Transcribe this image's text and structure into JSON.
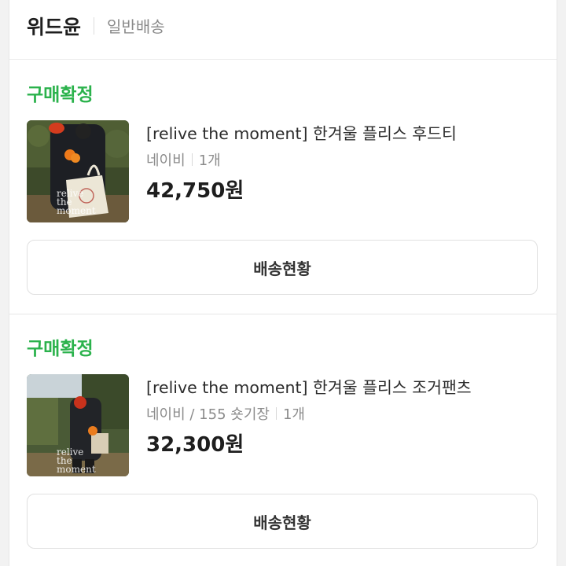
{
  "seller": {
    "name": "위드윤",
    "shipping_type": "일반배송"
  },
  "orders": [
    {
      "status": "구매확정",
      "product_name": "[relive the moment] 한겨울 플리스 후드티",
      "option": "네이비",
      "quantity": "1개",
      "price": "42,750원",
      "thumbnail_text": "relive the moment",
      "track_button": "배송현황"
    },
    {
      "status": "구매확정",
      "product_name": "[relive the moment] 한겨울 플리스 조거팬츠",
      "option": "네이비 / 155 숏기장",
      "quantity": "1개",
      "price": "32,300원",
      "thumbnail_text": "relive the moment",
      "track_button": "배송현황"
    }
  ],
  "colors": {
    "status_green": "#2bb24c",
    "text_dark": "#1e1e1e",
    "text_gray": "#8b8b8b"
  }
}
